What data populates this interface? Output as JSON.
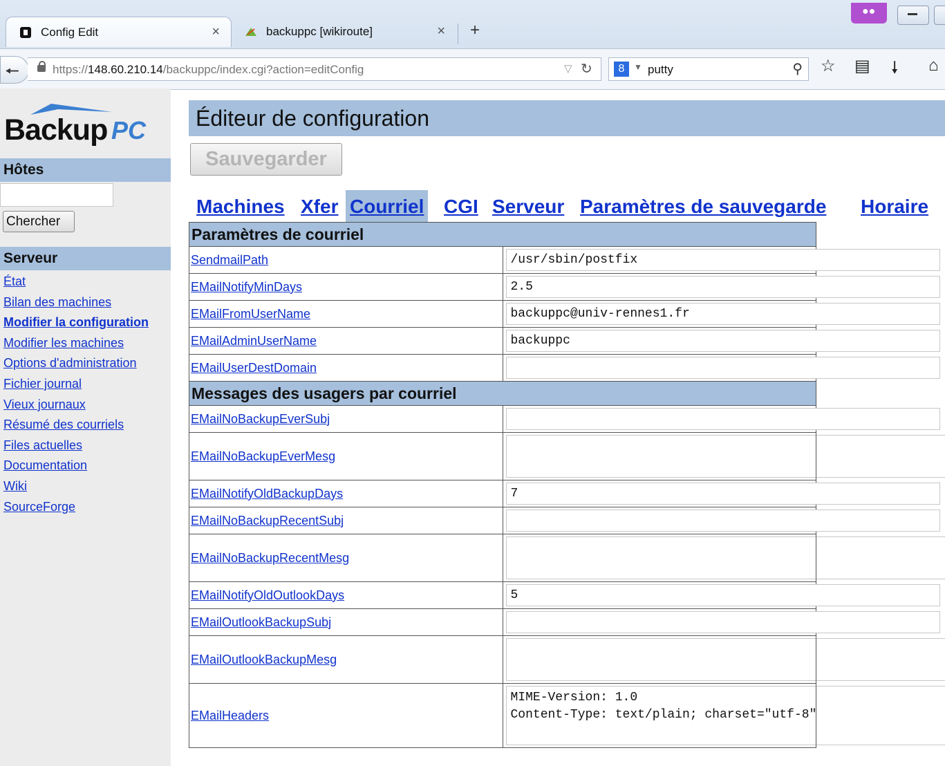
{
  "browser": {
    "tabs": [
      {
        "title": "Config Edit",
        "close": "×"
      },
      {
        "title": "backuppc [wikiroute]",
        "close": "×"
      }
    ],
    "new_tab": "+",
    "url_prefix": "https://",
    "url_host": "148.60.210.14",
    "url_path": "/backuppc/index.cgi?action=editConfig",
    "search_engine": "8",
    "search_query": "putty",
    "icons": [
      "back-icon",
      "lock-icon",
      "reload-icon",
      "search-icon",
      "bookmark-star-icon",
      "reading-list-icon",
      "download-icon",
      "home-icon"
    ]
  },
  "sidebar": {
    "logo_main": "Backup",
    "logo_suffix": "PC",
    "hosts_header": "Hôtes",
    "search_value": "",
    "search_button": "Chercher",
    "server_header": "Serveur",
    "links": [
      {
        "label": "État",
        "current": false
      },
      {
        "label": "Bilan des machines",
        "current": false
      },
      {
        "label": "Modifier la configuration",
        "current": true
      },
      {
        "label": "Modifier les machines",
        "current": false
      },
      {
        "label": "Options d'administration",
        "current": false
      },
      {
        "label": "Fichier journal",
        "current": false
      },
      {
        "label": "Vieux journaux",
        "current": false
      },
      {
        "label": "Résumé des courriels",
        "current": false
      },
      {
        "label": "Files actuelles",
        "current": false
      },
      {
        "label": "Documentation",
        "current": false
      },
      {
        "label": "Wiki",
        "current": false
      },
      {
        "label": "SourceForge",
        "current": false
      }
    ]
  },
  "main": {
    "title": "Éditeur de configuration",
    "save_button": "Sauvegarder",
    "tabs": [
      "Machines",
      "Xfer",
      "Courriel",
      "CGI",
      "Serveur",
      "Paramètres de sauvegarde",
      "Horaire"
    ],
    "selected_tab": "Courriel",
    "section1_title": "Paramètres de courriel",
    "section2_title": "Messages des usagers par courriel",
    "fields": {
      "SendmailPath": "/usr/sbin/postfix",
      "EMailNotifyMinDays": "2.5",
      "EMailFromUserName": "backuppc@univ-rennes1.fr",
      "EMailAdminUserName": "backuppc",
      "EMailUserDestDomain": "",
      "EMailNoBackupEverSubj": "",
      "EMailNoBackupEverMesg": "",
      "EMailNotifyOldBackupDays": "7",
      "EMailNoBackupRecentSubj": "",
      "EMailNoBackupRecentMesg": "",
      "EMailNotifyOldOutlookDays": "5",
      "EMailOutlookBackupSubj": "",
      "EMailOutlookBackupMesg": "",
      "EMailHeaders": "MIME-Version: 1.0\nContent-Type: text/plain; charset=\"utf-8\""
    },
    "labels": {
      "SendmailPath": "SendmailPath",
      "EMailNotifyMinDays": "EMailNotifyMinDays",
      "EMailFromUserName": "EMailFromUserName",
      "EMailAdminUserName": "EMailAdminUserName",
      "EMailUserDestDomain": "EMailUserDestDomain",
      "EMailNoBackupEverSubj": "EMailNoBackupEverSubj",
      "EMailNoBackupEverMesg": "EMailNoBackupEverMesg",
      "EMailNotifyOldBackupDays": "EMailNotifyOldBackupDays",
      "EMailNoBackupRecentSubj": "EMailNoBackupRecentSubj",
      "EMailNoBackupRecentMesg": "EMailNoBackupRecentMesg",
      "EMailNotifyOldOutlookDays": "EMailNotifyOldOutlookDays",
      "EMailOutlookBackupSubj": "EMailOutlookBackupSubj",
      "EMailOutlookBackupMesg": "EMailOutlookBackupMesg",
      "EMailHeaders": "EMailHeaders"
    }
  }
}
